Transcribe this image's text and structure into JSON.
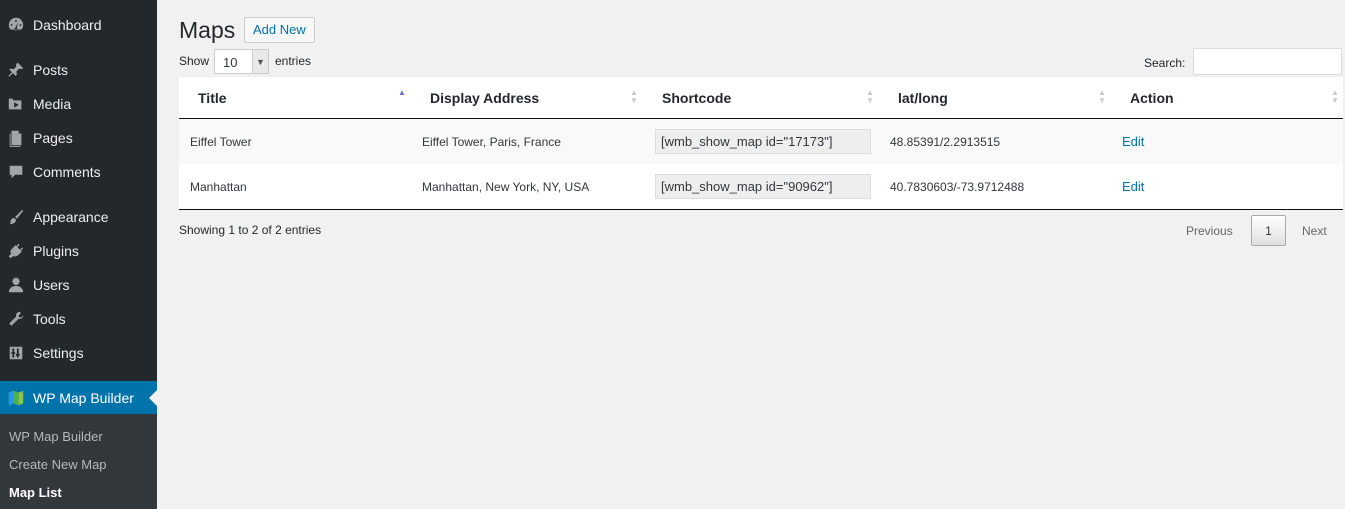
{
  "sidebar": {
    "items": [
      {
        "label": "Dashboard",
        "icon": "dashboard-icon"
      },
      {
        "label": "Posts",
        "icon": "pin-icon"
      },
      {
        "label": "Media",
        "icon": "media-icon"
      },
      {
        "label": "Pages",
        "icon": "pages-icon"
      },
      {
        "label": "Comments",
        "icon": "comment-icon"
      },
      {
        "label": "Appearance",
        "icon": "brush-icon"
      },
      {
        "label": "Plugins",
        "icon": "plug-icon"
      },
      {
        "label": "Users",
        "icon": "user-icon"
      },
      {
        "label": "Tools",
        "icon": "wrench-icon"
      },
      {
        "label": "Settings",
        "icon": "settings-icon"
      },
      {
        "label": "WP Map Builder",
        "icon": "map-icon"
      }
    ],
    "submenu": [
      {
        "label": "WP Map Builder"
      },
      {
        "label": "Create New Map"
      },
      {
        "label": "Map List"
      }
    ]
  },
  "header": {
    "title": "Maps",
    "add_new": "Add New"
  },
  "controls": {
    "show": "Show",
    "length_value": "10",
    "entries": "entries",
    "search_label": "Search:",
    "search_value": ""
  },
  "table": {
    "columns": [
      "Title",
      "Display Address",
      "Shortcode",
      "lat/long",
      "Action"
    ],
    "rows": [
      {
        "title": "Eiffel Tower",
        "address": "Eiffel Tower, Paris, France",
        "shortcode": "[wmb_show_map id=\"17173\"]",
        "latlong": "48.85391/2.2913515",
        "action": "Edit"
      },
      {
        "title": "Manhattan",
        "address": "Manhattan, New York, NY, USA",
        "shortcode": "[wmb_show_map id=\"90962\"]",
        "latlong": "40.7830603/-73.9712488",
        "action": "Edit"
      }
    ]
  },
  "footer": {
    "info": "Showing 1 to 2 of 2 entries",
    "previous": "Previous",
    "page": "1",
    "next": "Next"
  },
  "colors": {
    "sidebar_bg": "#23282d",
    "active_bg": "#0073aa",
    "link": "#0073aa"
  }
}
